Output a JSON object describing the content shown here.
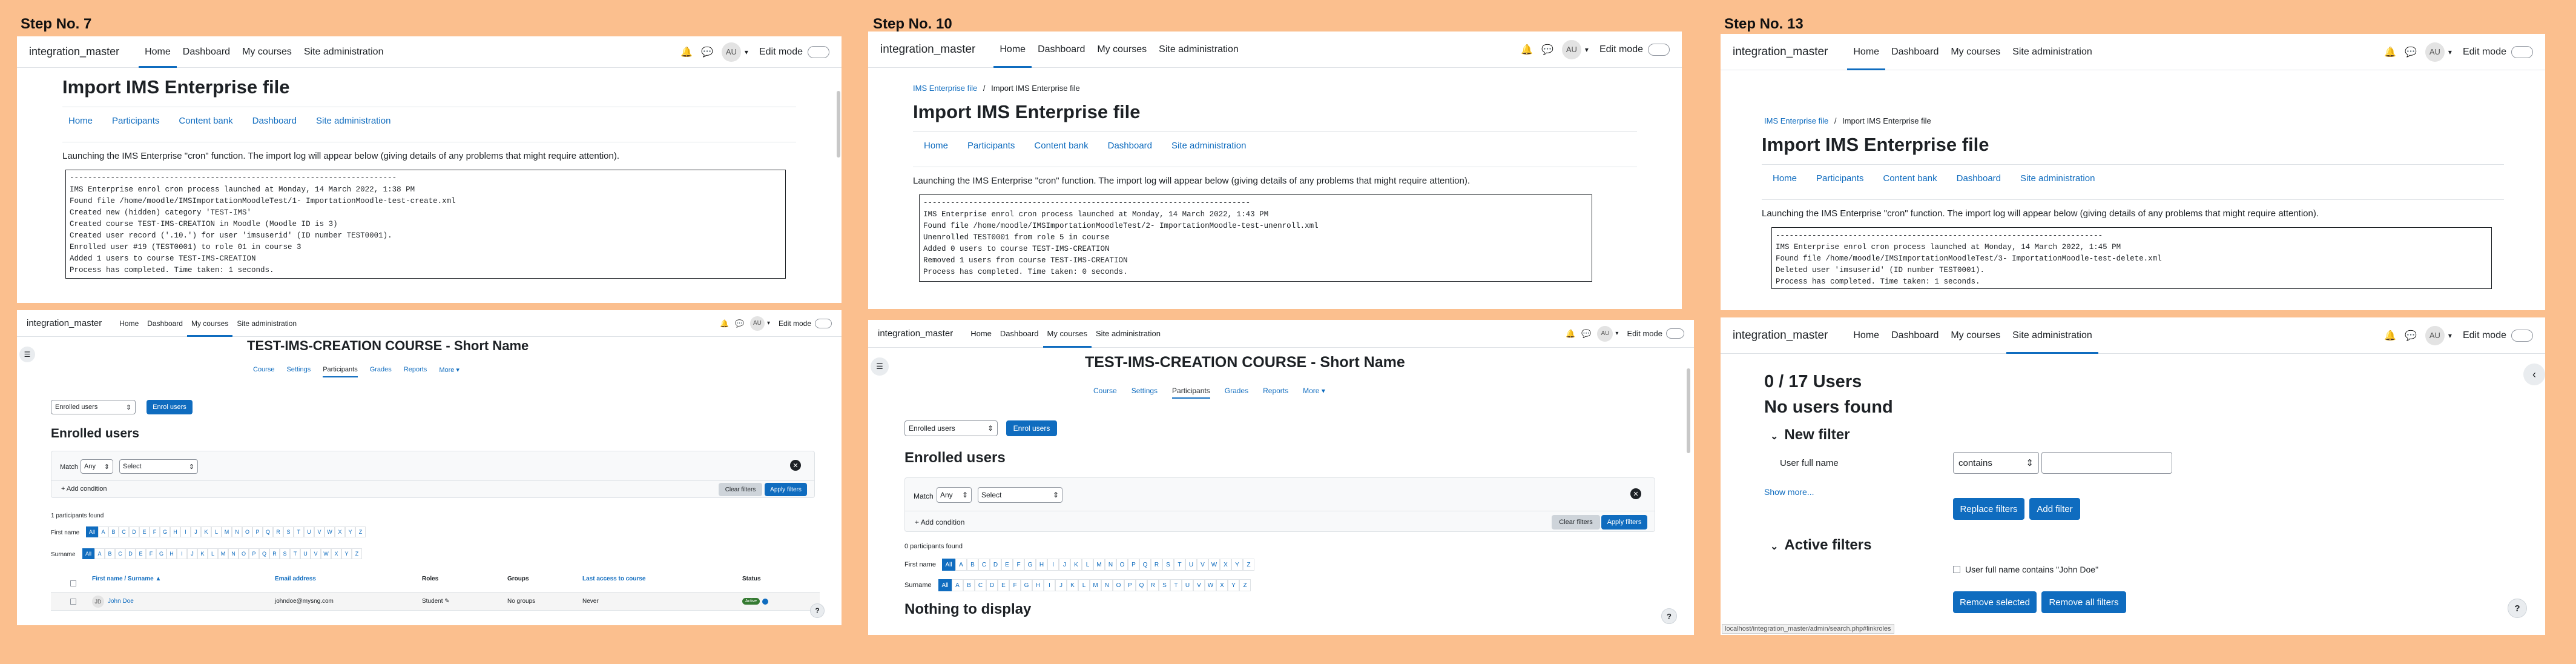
{
  "steps": {
    "s7": "Step No. 7",
    "s10": "Step No. 10",
    "s13": "Step No. 13"
  },
  "nav": {
    "site": "integration_master",
    "home": "Home",
    "dashboard": "Dashboard",
    "my_courses": "My courses",
    "site_admin": "Site administration",
    "avatar": "AU",
    "edit_mode": "Edit mode"
  },
  "ims": {
    "title": "Import IMS Enterprise file",
    "breadcrumb_link": "IMS Enterprise file",
    "breadcrumb_sep": "/",
    "breadcrumb_current": "Import IMS Enterprise file",
    "tabs": [
      "Home",
      "Participants",
      "Content bank",
      "Dashboard",
      "Site administration"
    ],
    "intro": "Launching the IMS Enterprise \"cron\" function. The import log will appear below (giving details of any problems that might require attention).",
    "log7": "------------------------------------------------------------------------\nIMS Enterprise enrol cron process launched at Monday, 14 March 2022, 1:38 PM\nFound file /home/moodle/IMSImportationMoodleTest/1- ImportationMoodle-test-create.xml\nCreated new (hidden) category 'TEST-IMS'\nCreated course TEST-IMS-CREATION in Moodle (Moodle ID is 3)\nCreated user record ('.10.') for user 'imsuserid' (ID number TEST0001).\nEnrolled user #19 (TEST0001) to role 01 in course 3\nAdded 1 users to course TEST-IMS-CREATION\nProcess has completed. Time taken: 1 seconds.",
    "log10": "------------------------------------------------------------------------\nIMS Enterprise enrol cron process launched at Monday, 14 March 2022, 1:43 PM\nFound file /home/moodle/IMSImportationMoodleTest/2- ImportationMoodle-test-unenroll.xml\nUnenrolled TEST0001 from role 5 in course\nAdded 0 users to course TEST-IMS-CREATION\nRemoved 1 users from course TEST-IMS-CREATION\nProcess has completed. Time taken: 0 seconds.",
    "log13": "------------------------------------------------------------------------\nIMS Enterprise enrol cron process launched at Monday, 14 March 2022, 1:45 PM\nFound file /home/moodle/IMSImportationMoodleTest/3- ImportationMoodle-test-delete.xml\nDeleted user 'imsuserid' (ID number TEST0001).\nProcess has completed. Time taken: 1 seconds."
  },
  "course": {
    "title": "TEST-IMS-CREATION COURSE - Short Name",
    "tabs": [
      "Course",
      "Settings",
      "Participants",
      "Grades",
      "Reports",
      "More ▾"
    ],
    "enrolled_select": "Enrolled users",
    "enrol_button": "Enrol users",
    "heading": "Enrolled users",
    "match": "Match",
    "any": "Any",
    "select": "Select",
    "add_condition": "Add condition",
    "clear_filters": "Clear filters",
    "apply_filters": "Apply filters",
    "participants_found_7": "1 participants found",
    "participants_found_10": "0 participants found",
    "first_name": "First name",
    "surname": "Surname",
    "letters": [
      "All",
      "A",
      "B",
      "C",
      "D",
      "E",
      "F",
      "G",
      "H",
      "I",
      "J",
      "K",
      "L",
      "M",
      "N",
      "O",
      "P",
      "Q",
      "R",
      "S",
      "T",
      "U",
      "V",
      "W",
      "X",
      "Y",
      "Z"
    ],
    "columns": [
      "First name / Surname ▲",
      "Email address",
      "Roles",
      "Groups",
      "Last access to course",
      "Status"
    ],
    "row": {
      "initials": "JD",
      "name": "John Doe",
      "email": "johndoe@mysng.com",
      "role": "Student",
      "groups": "No groups",
      "last_access": "Never",
      "status": "Active"
    },
    "nothing": "Nothing to display"
  },
  "admin": {
    "count": "0 / 17 Users",
    "none": "No users found",
    "new_filter": "New filter",
    "user_full_name": "User full name",
    "contains": "contains",
    "show_more": "Show more...",
    "replace_filters": "Replace filters",
    "add_filter": "Add filter",
    "active_filters": "Active filters",
    "active_item": "User full name contains \"John Doe\"",
    "remove_selected": "Remove selected",
    "remove_all": "Remove all filters",
    "status_url": "localhost/integration_master/admin/search.php#linkroles"
  },
  "colors": {
    "accent": "#0f6cbf",
    "background": "#fbbf8e",
    "active_badge": "#357a32"
  }
}
